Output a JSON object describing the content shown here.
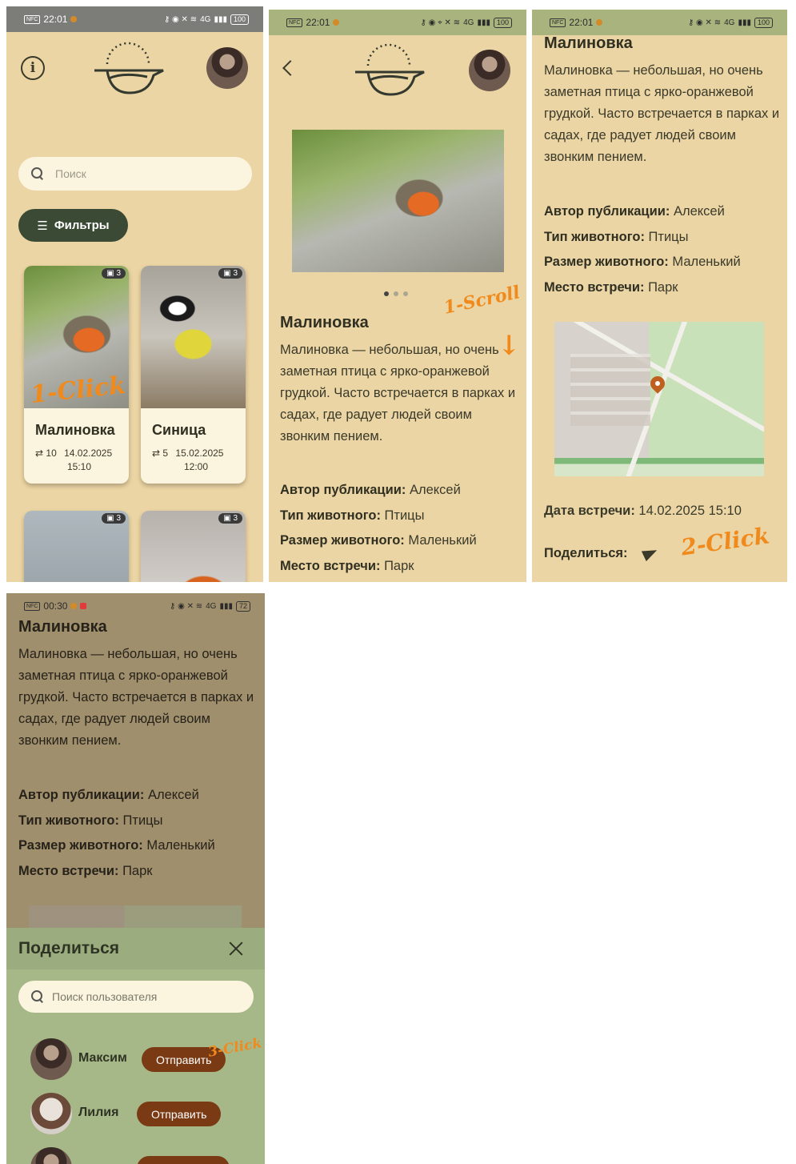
{
  "status": {
    "time1": "22:01",
    "time4": "00:30",
    "signal": "4G",
    "battery1": "100",
    "battery4": "72"
  },
  "annotations": {
    "click1": "1-Click",
    "scroll1": "1-Scroll",
    "click2": "2-Click",
    "click3": "3-Click"
  },
  "feed": {
    "search_placeholder": "Поиск",
    "filters_label": "Фильтры",
    "cards": [
      {
        "name": "Малиновка",
        "photos": "3",
        "reposts": "10",
        "date": "14.02.2025",
        "time": "15:10"
      },
      {
        "name": "Синица",
        "photos": "3",
        "reposts": "5",
        "date": "15.02.2025",
        "time": "12:00"
      },
      {
        "photos": "3"
      },
      {
        "photos": "3"
      }
    ]
  },
  "post": {
    "title": "Малиновка",
    "description": "Малиновка — небольшая, но очень заметная птица с ярко-оранжевой грудкой. Часто встречается в парках и садах, где радует людей своим звонким пением.",
    "author_label": "Автор публикации:",
    "author": "Алексей",
    "type_label": "Тип животного:",
    "type": "Птицы",
    "size_label": "Размер животного:",
    "size": "Маленький",
    "place_label": "Место встречи:",
    "place": "Парк",
    "date_label": "Дата встречи:",
    "date": "14.02.2025 15:10",
    "share_label": "Поделиться:"
  },
  "share_sheet": {
    "title": "Поделиться",
    "search_placeholder": "Поиск пользователя",
    "users": [
      {
        "name": "Максим",
        "button": "Отправить"
      },
      {
        "name": "Лилия",
        "button": "Отправить"
      }
    ]
  },
  "colors": {
    "background": "#ecd5a4",
    "accent_dark": "#3a4a34",
    "send_button": "#7a3a14",
    "annotation": "#f08a1c"
  }
}
